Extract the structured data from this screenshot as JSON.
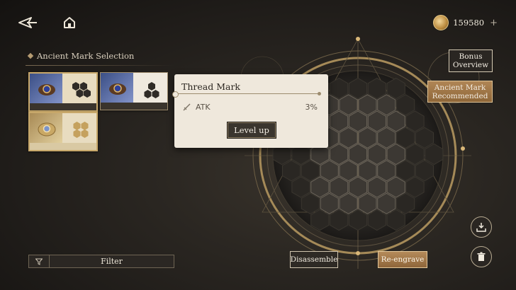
{
  "header": {
    "currency_amount": "159580",
    "plus_label": "+"
  },
  "selection_panel": {
    "title": "Ancient Mark Selection",
    "filter_label": "Filter"
  },
  "popup": {
    "title": "Thread Mark",
    "stat_name": "ATK",
    "stat_value": "3%",
    "level_up_label": "Level up"
  },
  "side_buttons": {
    "bonus_overview": [
      "Bonus",
      "Overview"
    ],
    "ancient_mark_recommended": [
      "Ancient Mark",
      "Recommended"
    ]
  },
  "bottom_actions": {
    "disassemble_label": "Disassemble",
    "reengrave_label": "Re-engrave"
  },
  "icons": [
    "back-arrow-icon",
    "home-icon",
    "coin-icon",
    "filter-icon",
    "sword-icon",
    "download-icon",
    "trash-icon",
    "hex-slot-icon"
  ]
}
